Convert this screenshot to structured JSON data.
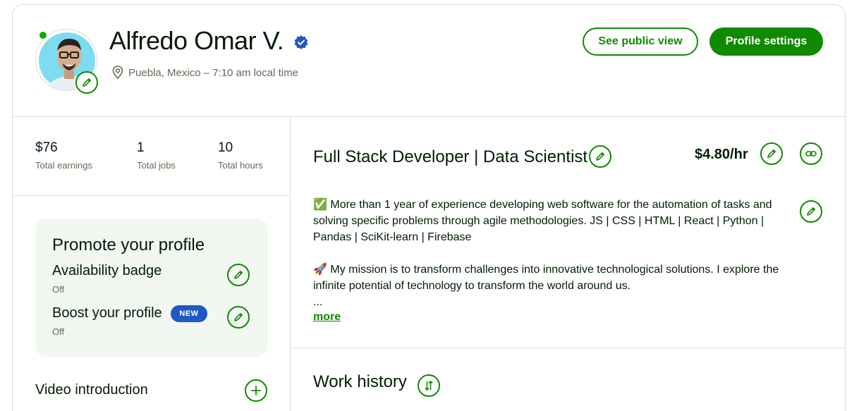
{
  "profile": {
    "name": "Alfredo Omar V.",
    "location": "Puebla, Mexico – 7:10 am local time",
    "online_status_color": "#14a800",
    "verified_icon": "verified-badge-icon"
  },
  "header_actions": {
    "public_view_label": "See public view",
    "settings_label": "Profile settings"
  },
  "stats": [
    {
      "value": "$76",
      "label": "Total earnings"
    },
    {
      "value": "1",
      "label": "Total jobs"
    },
    {
      "value": "10",
      "label": "Total hours"
    }
  ],
  "promote": {
    "title": "Promote your profile",
    "items": [
      {
        "title": "Availability badge",
        "status": "Off"
      },
      {
        "title": "Boost your profile",
        "status": "Off",
        "badge": "NEW"
      }
    ]
  },
  "video": {
    "title": "Video introduction"
  },
  "overview": {
    "title": "Full Stack Developer | Data Scientist",
    "rate": "$4.80/hr",
    "desc_line1": "✅ More than 1 year of experience developing web software for the automation of tasks and solving specific problems through agile methodologies. JS | CSS | HTML | React | Python | Pandas | SciKit-learn | Firebase",
    "desc_line2": "🚀 My mission is to transform challenges into innovative technological solutions. I explore the infinite potential of technology to transform the world around us.",
    "ellipsis": "...",
    "more_label": "more"
  },
  "work_history": {
    "title": "Work history"
  },
  "colors": {
    "brand_green": "#108a00",
    "text": "#001e00",
    "muted": "#5e6d55",
    "badge_blue": "#1f57c3",
    "border": "#d5e0d5"
  }
}
